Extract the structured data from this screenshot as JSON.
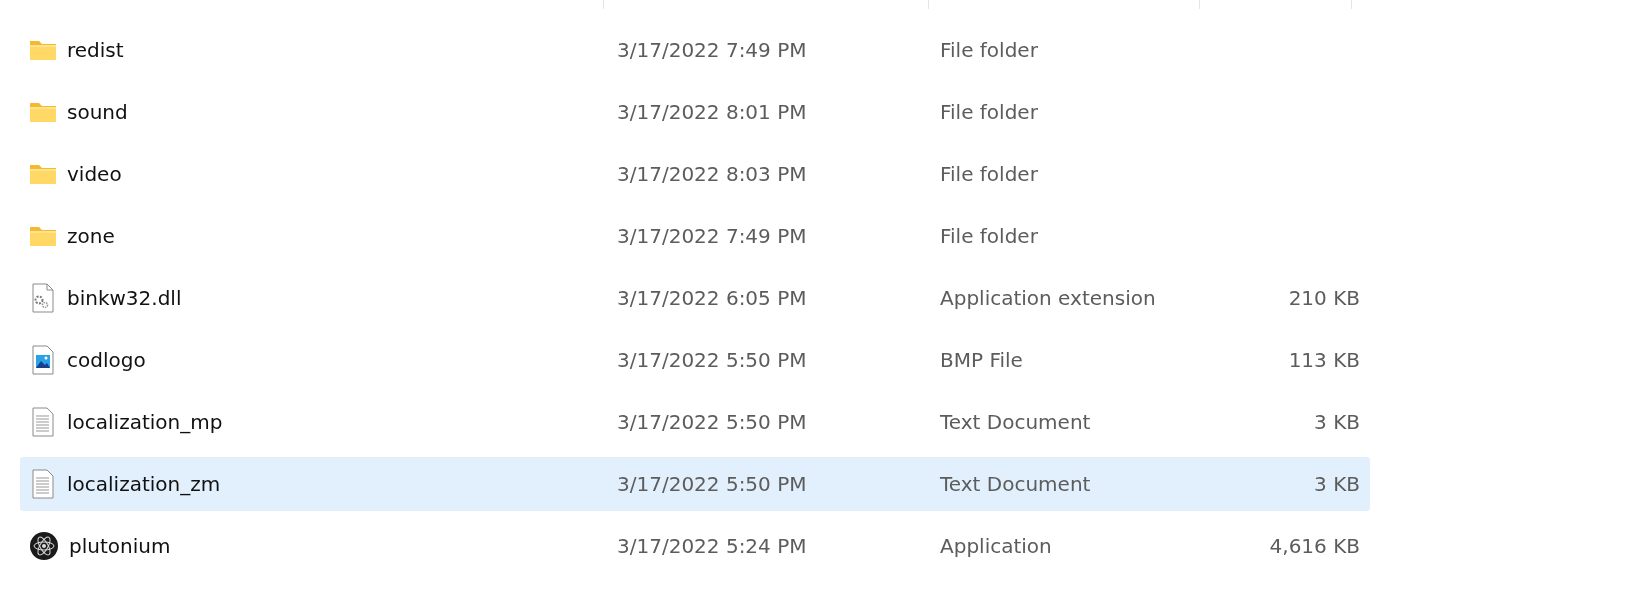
{
  "files": [
    {
      "kind": "folder",
      "name": "redist",
      "date_modified": "3/17/2022 7:49 PM",
      "type": "File folder",
      "selected": false
    },
    {
      "kind": "folder",
      "name": "sound",
      "date_modified": "3/17/2022 8:01 PM",
      "type": "File folder",
      "selected": false
    },
    {
      "kind": "folder",
      "name": "video",
      "date_modified": "3/17/2022 8:03 PM",
      "type": "File folder",
      "selected": false
    },
    {
      "kind": "folder",
      "name": "zone",
      "date_modified": "3/17/2022 7:49 PM",
      "type": "File folder",
      "selected": false
    },
    {
      "kind": "dll",
      "name": "binkw32.dll",
      "date_modified": "3/17/2022 6:05 PM",
      "type": "Application extension",
      "size": "210 KB",
      "selected": false
    },
    {
      "kind": "image",
      "name": "codlogo",
      "date_modified": "3/17/2022 5:50 PM",
      "type": "BMP File",
      "size": "113 KB",
      "selected": false
    },
    {
      "kind": "text",
      "name": "localization_mp",
      "date_modified": "3/17/2022 5:50 PM",
      "type": "Text Document",
      "size": "3 KB",
      "selected": false
    },
    {
      "kind": "text",
      "name": "localization_zm",
      "date_modified": "3/17/2022 5:50 PM",
      "type": "Text Document",
      "size": "3 KB",
      "selected": true
    },
    {
      "kind": "app",
      "name": "plutonium",
      "date_modified": "3/17/2022 5:24 PM",
      "type": "Application",
      "size": "4,616 KB",
      "selected": false
    }
  ]
}
